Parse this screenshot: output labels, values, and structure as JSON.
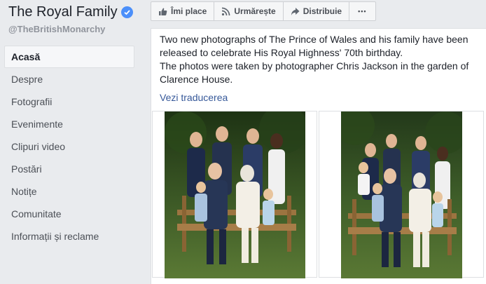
{
  "sidebar": {
    "page_name": "The Royal Family",
    "handle": "@TheBritishMonarchy",
    "items": [
      {
        "label": "Acasă"
      },
      {
        "label": "Despre"
      },
      {
        "label": "Fotografii"
      },
      {
        "label": "Evenimente"
      },
      {
        "label": "Clipuri video"
      },
      {
        "label": "Postări"
      },
      {
        "label": "Notițe"
      },
      {
        "label": "Comunitate"
      },
      {
        "label": "Informații și reclame"
      }
    ]
  },
  "actions": {
    "like": "Îmi place",
    "follow": "Urmărește",
    "share": "Distribuie",
    "more": "•••"
  },
  "post": {
    "text_line1": "Two new photographs of The Prince of Wales and his family have been released to celebrate His Royal Highness' 70th birthday.",
    "text_line2": "The photos were taken by photographer Chris Jackson in the garden of Clarence House.",
    "translate": "Vezi traducerea"
  },
  "colors": {
    "accent": "#365899",
    "verified": "#4b8ffa"
  }
}
